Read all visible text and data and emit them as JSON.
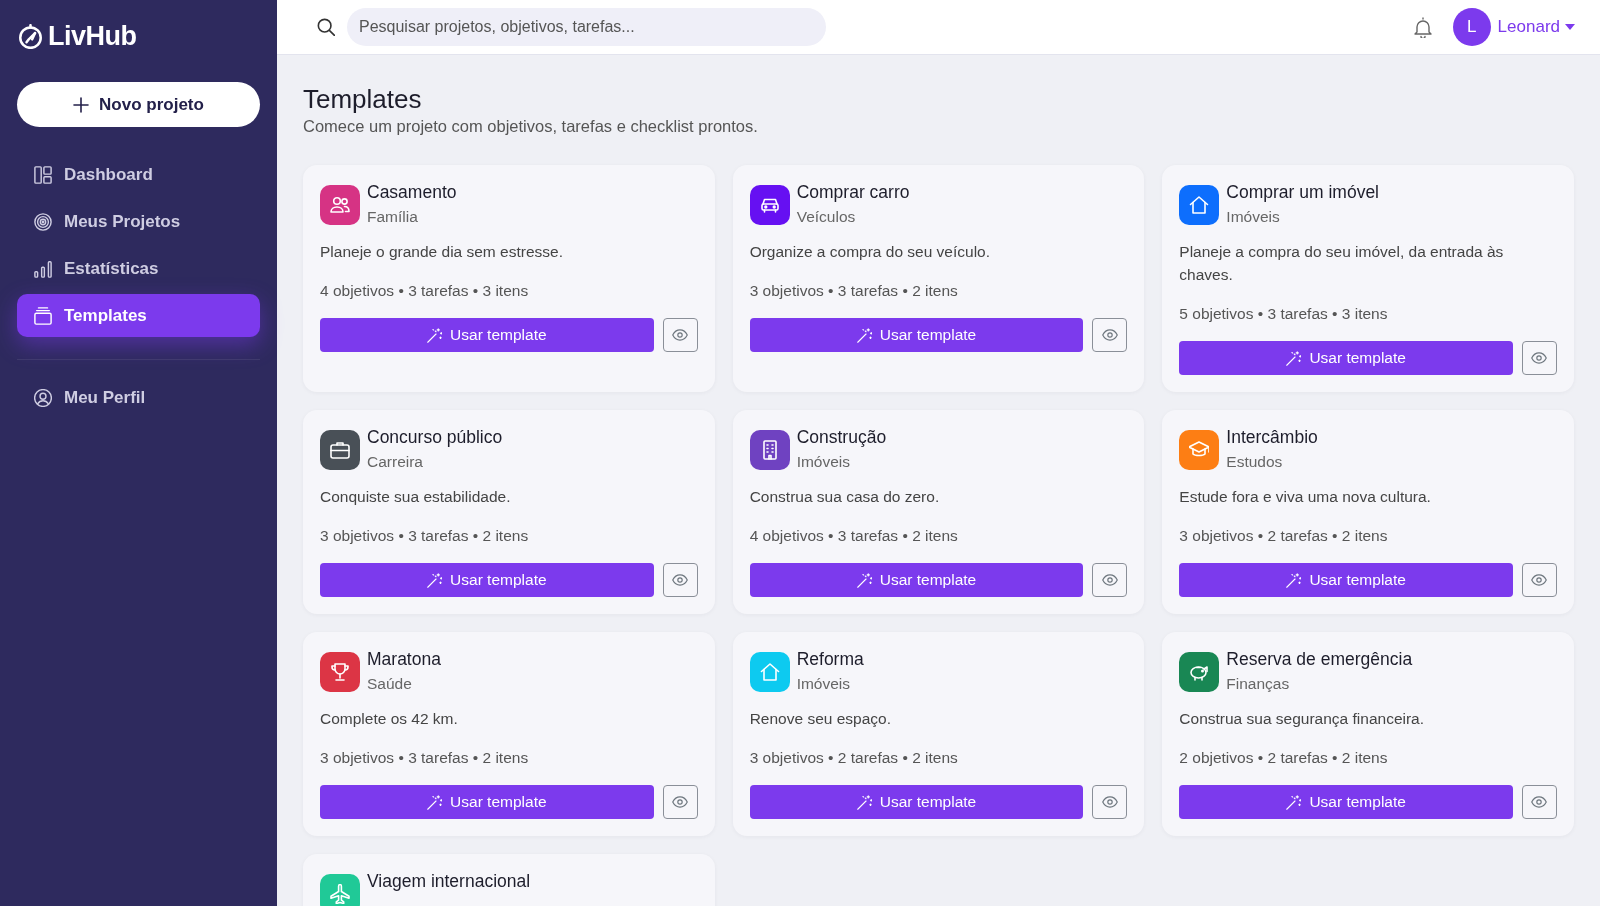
{
  "sidebar": {
    "logo": "LivHub",
    "new_project_button": "Novo projeto",
    "items": [
      {
        "label": "Dashboard",
        "selected": false
      },
      {
        "label": "Meus Projetos",
        "selected": false
      },
      {
        "label": "Estatísticas",
        "selected": false
      },
      {
        "label": "Templates",
        "selected": true
      }
    ],
    "footer_items": [
      {
        "label": "Meu Perfil",
        "selected": false
      }
    ]
  },
  "header": {
    "search": {
      "placeholder": "Pesquisar projetos, objetivos, tarefas..."
    },
    "user": {
      "initial": "L",
      "name": "Leonard"
    }
  },
  "page": {
    "title": "Templates",
    "subtitle": "Comece um projeto com objetivos, tarefas e checklist prontos."
  },
  "templates": [
    {
      "title": "Casamento",
      "category": "Família",
      "description": "Planeje o grande dia sem estresse.",
      "stats": "4 objetivos • 3 tarefas • 3 itens",
      "button": "Usar template",
      "color": "#d63384"
    },
    {
      "title": "Comprar carro",
      "category": "Veículos",
      "description": "Organize a compra do seu veículo.",
      "stats": "3 objetivos • 3 tarefas • 2 itens",
      "button": "Usar template",
      "color": "#6610f2"
    },
    {
      "title": "Comprar um imóvel",
      "category": "Imóveis",
      "description": "Planeje a compra do seu imóvel, da entrada às chaves.",
      "stats": "5 objetivos • 3 tarefas • 3 itens",
      "button": "Usar template",
      "color": "#0d6efd"
    },
    {
      "title": "Concurso público",
      "category": "Carreira",
      "description": "Conquiste sua estabilidade.",
      "stats": "3 objetivos • 3 tarefas • 2 itens",
      "button": "Usar template",
      "color": "#495057"
    },
    {
      "title": "Construção",
      "category": "Imóveis",
      "description": "Construa sua casa do zero.",
      "stats": "4 objetivos • 3 tarefas • 2 itens",
      "button": "Usar template",
      "color": "#6f42c1"
    },
    {
      "title": "Intercâmbio",
      "category": "Estudos",
      "description": "Estude fora e viva uma nova cultura.",
      "stats": "3 objetivos • 2 tarefas • 2 itens",
      "button": "Usar template",
      "color": "#fd7e14"
    },
    {
      "title": "Maratona",
      "category": "Saúde",
      "description": "Complete os 42 km.",
      "stats": "3 objetivos • 3 tarefas • 2 itens",
      "button": "Usar template",
      "color": "#dc3545"
    },
    {
      "title": "Reforma",
      "category": "Imóveis",
      "description": "Renove seu espaço.",
      "stats": "3 objetivos • 2 tarefas • 2 itens",
      "button": "Usar template",
      "color": "#0dcaf0"
    },
    {
      "title": "Reserva de emergência",
      "category": "Finanças",
      "description": "Construa sua segurança financeira.",
      "stats": "2 objetivos • 2 tarefas • 2 itens",
      "button": "Usar template",
      "color": "#198754"
    },
    {
      "title": "Viagem internacional",
      "color": "#20c997"
    }
  ]
}
